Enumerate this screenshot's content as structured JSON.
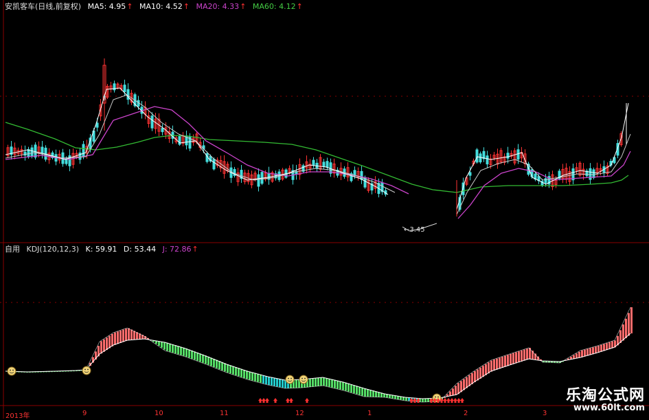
{
  "main_panel": {
    "title": "安凯客车(日线,前复权)",
    "ma": [
      {
        "label": "MA5: 4.95",
        "color": "#ffffff"
      },
      {
        "label": "MA10: 4.52",
        "color": "#ffffff"
      },
      {
        "label": "MA20: 4.33",
        "color": "#cc44cc"
      },
      {
        "label": "MA60: 4.12",
        "color": "#44cc44"
      }
    ],
    "arrow": "↑",
    "low_label": "←3.45"
  },
  "sub_panel": {
    "title": "自用",
    "kdj": [
      {
        "label": "KDJ(120,12,3)",
        "color": "#ffffff"
      },
      {
        "label": "K: 59.91",
        "color": "#ffffff"
      },
      {
        "label": "D: 53.44",
        "color": "#ffffff"
      },
      {
        "label": "J: 72.86",
        "color": "#cc44cc"
      }
    ]
  },
  "x_axis": {
    "ticks": [
      "2013年",
      "9",
      "10",
      "11",
      "12",
      "1",
      "2",
      "3"
    ]
  },
  "watermark": {
    "title": "乐淘公式网",
    "url": "www.60lt.com"
  },
  "colors": {
    "grid": "#8a0000",
    "up_candle": "#ff3333",
    "down_candle": "#44dddd",
    "ma_white": "#ffffff",
    "ma_purple": "#cc44cc",
    "ma_green": "#33bb33"
  }
}
